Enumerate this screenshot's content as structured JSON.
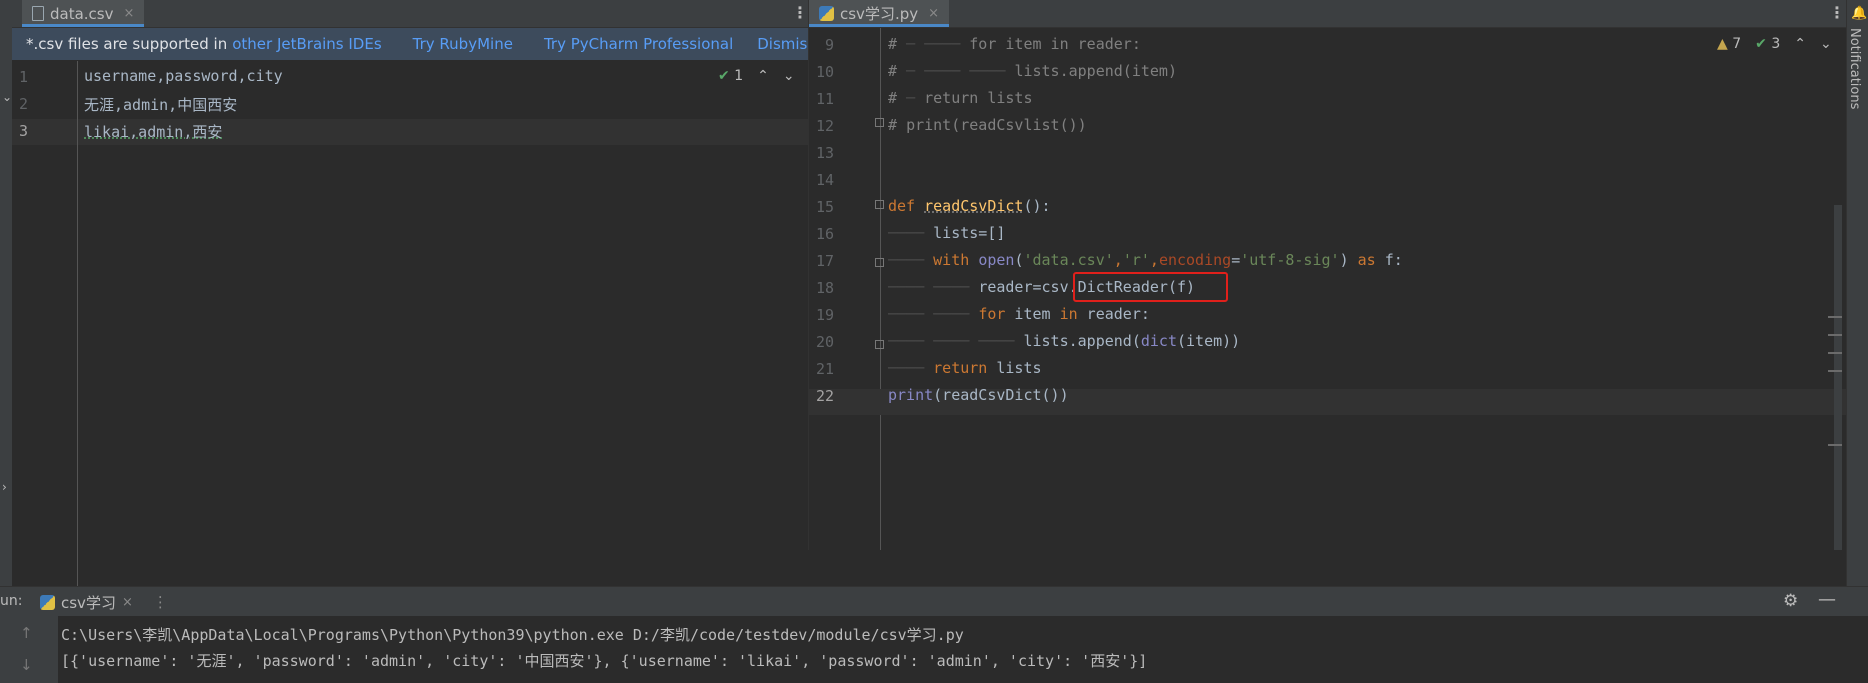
{
  "left_tab": {
    "label": "data.csv",
    "close": "×"
  },
  "right_tab": {
    "label": "csv学习.py",
    "close": "×"
  },
  "banner": {
    "text": "*.csv files are supported in",
    "link_other": "other JetBrains IDEs",
    "link_rubymine": "Try RubyMine",
    "link_pycharm": "Try PyCharm Professional",
    "link_dismiss": "Dismiss"
  },
  "left_inspect": {
    "ok_count": "1"
  },
  "left_lines": [
    {
      "n": "1",
      "text": "username,password,city"
    },
    {
      "n": "2",
      "text": "无涯,admin,中国西安"
    },
    {
      "n": "3",
      "text": "likai,admin,西安"
    }
  ],
  "right_inspect": {
    "warnings": "7",
    "ok_count": "3"
  },
  "right_line_numbers": [
    "9",
    "10",
    "11",
    "12",
    "13",
    "14",
    "15",
    "16",
    "17",
    "18",
    "19",
    "20",
    "21",
    "22"
  ],
  "code": {
    "l9": "for item in reader:",
    "l10": "lists.append(item)",
    "l11": "return lists",
    "l12": "print(readCsvlist())",
    "l15_kw": "def",
    "l15_fn": "readCsvDict",
    "l15_rest": "():",
    "l16": "lists=[]",
    "l17_with": "with",
    "l17_open": "open",
    "l17_p1": "(",
    "l17_s1": "'data.csv'",
    "l17_c1": ",",
    "l17_s2": "'r'",
    "l17_c2": ",",
    "l17_enc": "encoding",
    "l17_eq": "=",
    "l17_s3": "'utf-8-sig'",
    "l17_p2": ") ",
    "l17_as": "as",
    "l17_f": " f:",
    "l18_a": "reader=csv.",
    "l18_b": "DictReader(f)",
    "l19_for": "for",
    "l19_mid": " item ",
    "l19_in": "in",
    "l19_end": " reader:",
    "l20_a": "lists.append(",
    "l20_dict": "dict",
    "l20_b": "(item))",
    "l21_kw": "return",
    "l21_rest": " lists",
    "l22_print": "print",
    "l22_rest": "(readCsvDict())"
  },
  "comment_hash": "#",
  "notifications_label": "Notifications",
  "run": {
    "label": "un:",
    "tab": "csv学习",
    "close": "×",
    "command": "C:\\Users\\李凯\\AppData\\Local\\Programs\\Python\\Python39\\python.exe D:/李凯/code/testdev/module/csv学习.py",
    "output": "[{'username': '无涯', 'password': 'admin', 'city': '中国西安'}, {'username': 'likai', 'password': 'admin', 'city': '西安'}]"
  },
  "colors": {
    "accent": "#4a88c7",
    "highlight_box": "#e0201b",
    "banner_bg": "#3d4b5c"
  }
}
